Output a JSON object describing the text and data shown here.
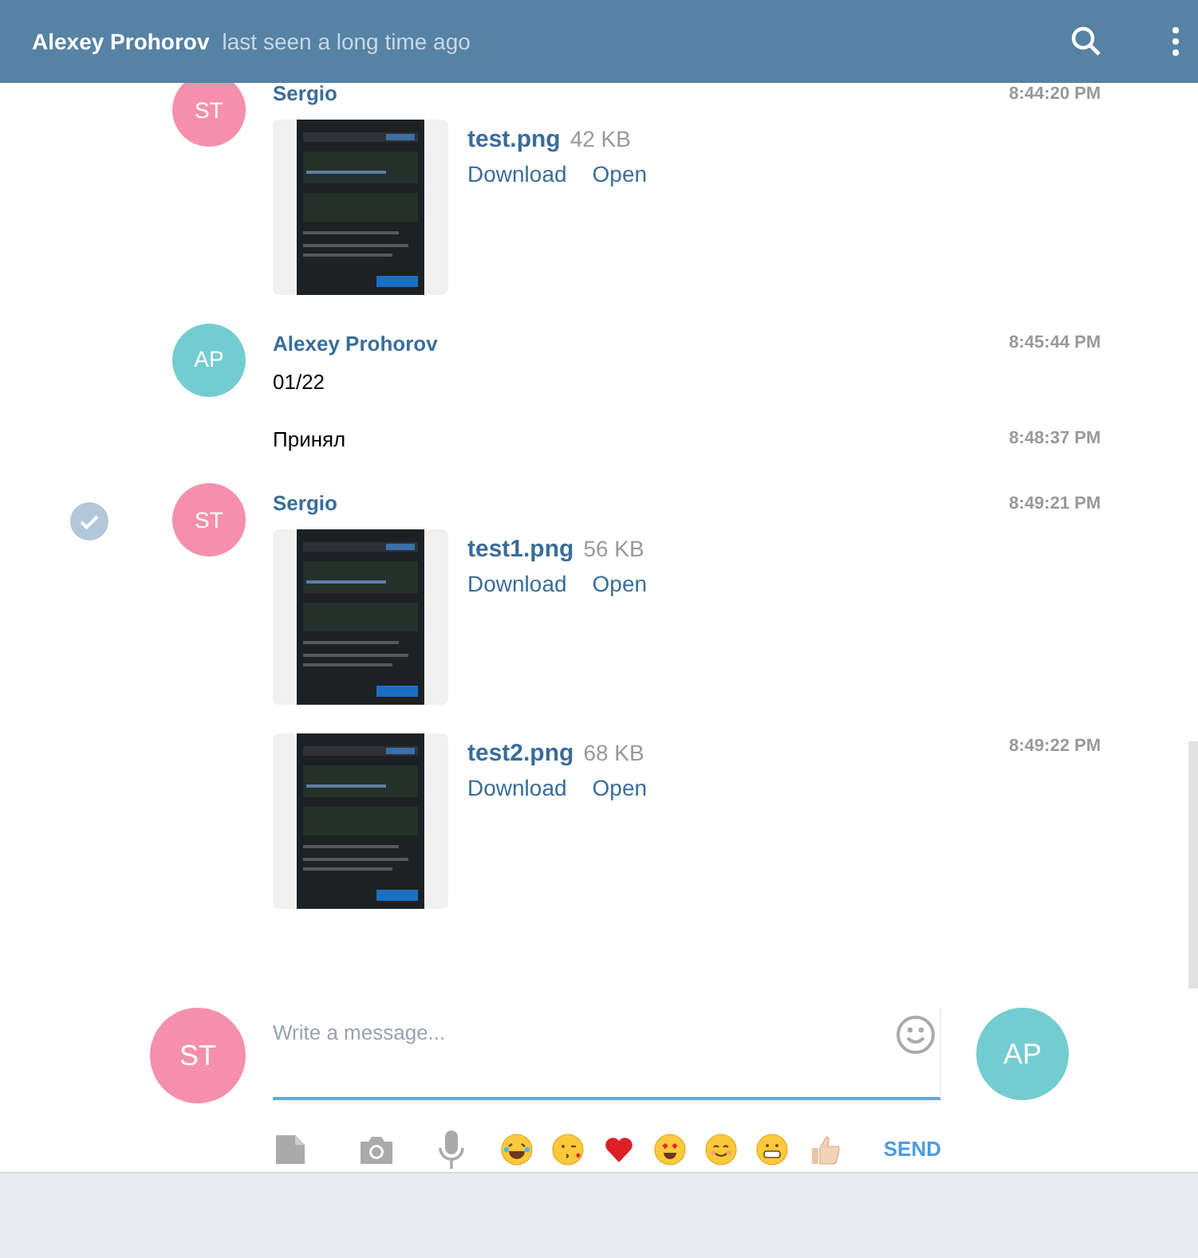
{
  "header": {
    "title": "Alexey Prohorov",
    "status": "last seen a long time ago"
  },
  "groups": [
    {
      "author": "Sergio",
      "initials": "ST",
      "color": "#f68fae",
      "selected": false,
      "items": [
        {
          "kind": "file",
          "name": "test.png",
          "size": "42 KB",
          "actions": [
            "Download",
            "Open"
          ],
          "time": "8:44:20 PM"
        }
      ]
    },
    {
      "author": "Alexey Prohorov",
      "initials": "AP",
      "color": "#73cdd0",
      "selected": false,
      "items": [
        {
          "kind": "text",
          "text": "01/22",
          "time": "8:45:44 PM"
        },
        {
          "kind": "text",
          "text": "Принял",
          "time": "8:48:37 PM"
        }
      ]
    },
    {
      "author": "Sergio",
      "initials": "ST",
      "color": "#f68fae",
      "selected": true,
      "items": [
        {
          "kind": "file",
          "name": "test1.png",
          "size": "56 KB",
          "actions": [
            "Download",
            "Open"
          ],
          "time": "8:49:21 PM"
        },
        {
          "kind": "file",
          "name": "test2.png",
          "size": "68 KB",
          "actions": [
            "Download",
            "Open"
          ],
          "time": "8:49:22 PM"
        }
      ]
    }
  ],
  "compose": {
    "my_initials": "ST",
    "peer_initials": "AP",
    "placeholder": "Write a message...",
    "send": "SEND"
  }
}
